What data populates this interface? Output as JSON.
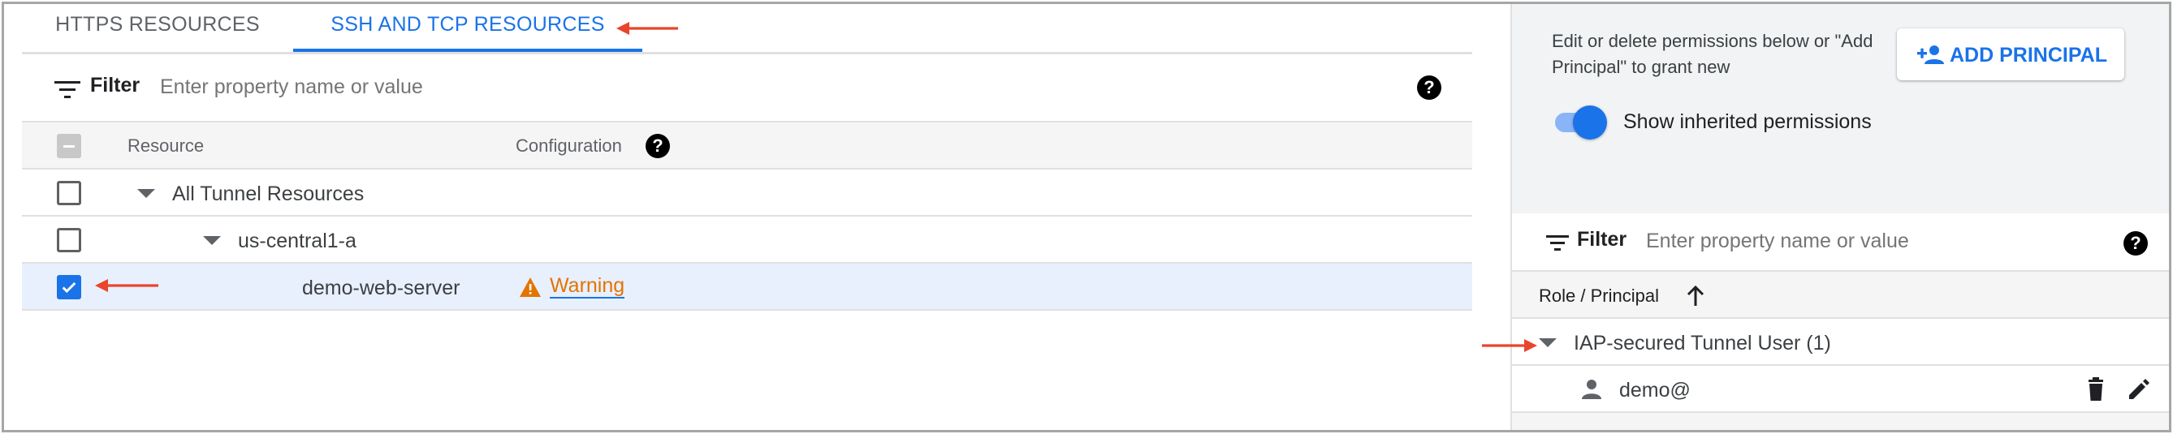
{
  "tabs": [
    {
      "label": "HTTPS RESOURCES",
      "active": false
    },
    {
      "label": "SSH AND TCP RESOURCES",
      "active": true
    }
  ],
  "filter": {
    "label": "Filter",
    "placeholder": "Enter property name or value"
  },
  "table": {
    "columns": [
      "Resource",
      "Configuration"
    ],
    "rows": [
      {
        "name": "All Tunnel Resources",
        "checked": false,
        "expanded": true,
        "level": 0
      },
      {
        "name": "us-central1-a",
        "checked": false,
        "expanded": true,
        "level": 1
      },
      {
        "name": "demo-web-server",
        "checked": true,
        "level": 2,
        "configuration": "Warning"
      }
    ]
  },
  "permissions": {
    "info": "Edit or delete permissions below or \"Add Principal\" to grant new",
    "add_button": "ADD PRINCIPAL",
    "toggle_label": "Show inherited permissions",
    "toggle_on": true,
    "filter": {
      "label": "Filter",
      "placeholder": "Enter property name or value"
    },
    "column": "Role / Principal",
    "role_group": "IAP-secured Tunnel User (1)",
    "principal": "demo@"
  },
  "colors": {
    "accent": "#1a73e8",
    "warning": "#e37400",
    "annotation_arrow": "#e8452c",
    "selected_row": "#e8f0fe"
  },
  "icons": [
    "filter-icon",
    "help-icon",
    "caret-down-icon",
    "check-icon",
    "warning-icon",
    "add-person-icon",
    "sort-up-icon",
    "person-icon",
    "delete-icon",
    "edit-icon",
    "annotation-arrow-icon"
  ]
}
